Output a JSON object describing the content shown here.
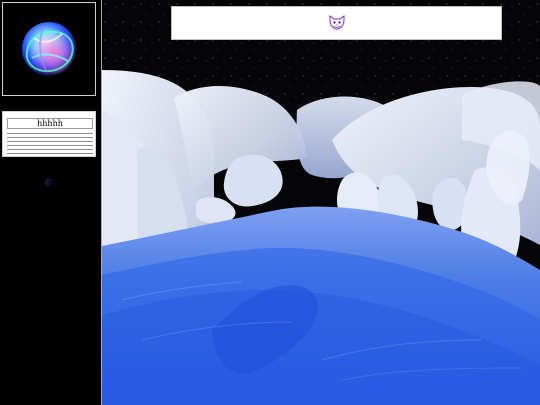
{
  "sidebar": {
    "logo": {
      "icon": "orb-logo-icon"
    },
    "menu": {
      "items": [
        {
          "label": "hhhhh"
        }
      ]
    },
    "copyright": "©"
  },
  "header": {
    "icon": "cat-face-icon"
  },
  "colors": {
    "page_bg": "#000000",
    "copyright_color": "#5b2bd0",
    "sky": "#050507",
    "ice": "#2f63e6",
    "rock": "#cfd6e6"
  }
}
